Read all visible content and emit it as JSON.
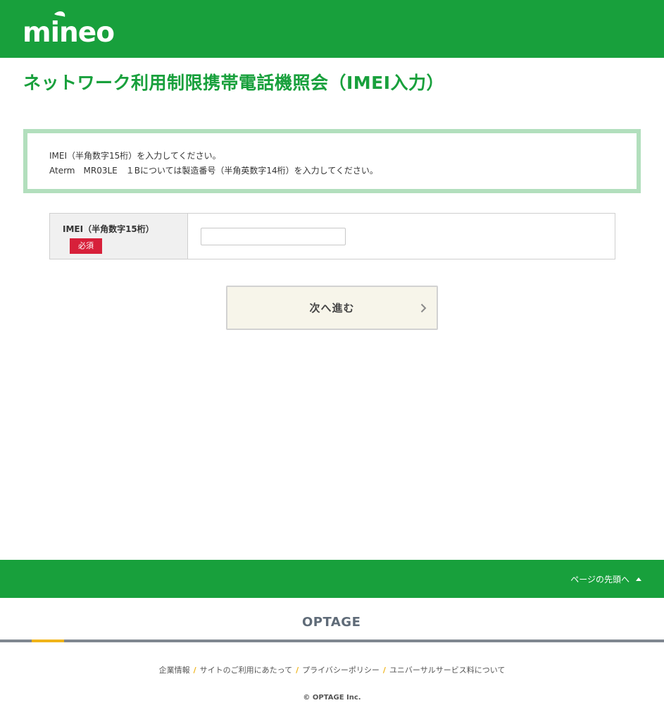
{
  "header": {
    "logo_text": "mineo",
    "brand_color": "#18a03c"
  },
  "page_title": "ネットワーク利用制限携帯電話機照会（IMEI入力）",
  "notice": {
    "line1": "IMEI（半角数字15桁）を入力してください。",
    "line2": "Aterm　MR03LE　１Bについては製造番号（半角英数字14桁）を入力してください。",
    "border_color": "#b2dfbd"
  },
  "form": {
    "imei_label": "IMEI（半角数字15桁）",
    "required_badge": "必須",
    "imei_value": "",
    "badge_color": "#d7203a"
  },
  "next_button": {
    "label": "次へ進む",
    "icon": "chevron-right-icon"
  },
  "footer": {
    "page_top_label": "ページの先頭へ",
    "page_top_icon": "triangle-up-icon",
    "company_logo_text": "OPTAGE",
    "links": [
      "企業情報",
      "サイトのご利用にあたって",
      "プライバシーポリシー",
      "ユニバーサルサービス料について"
    ],
    "separator": "/",
    "separator_color": "#f0b419",
    "copyright": "© OPTAGE Inc."
  }
}
